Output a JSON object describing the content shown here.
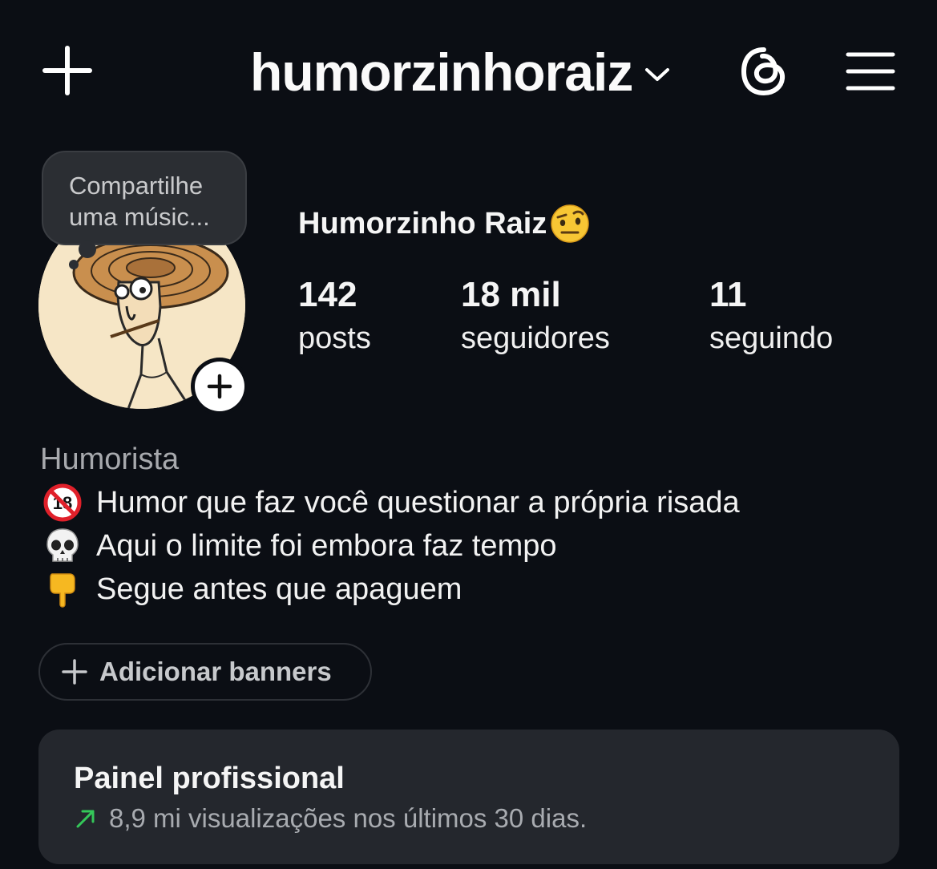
{
  "header": {
    "username": "humorzinhoraiz",
    "icons": [
      "plus-icon",
      "chevron-down-icon",
      "threads-icon",
      "menu-icon"
    ]
  },
  "note_bubble": {
    "text_line1": "Compartilhe",
    "text_line2": "uma músic..."
  },
  "profile": {
    "display_name": "Humorzinho Raiz",
    "stats": [
      {
        "value": "142",
        "label": "posts"
      },
      {
        "value": "18 mil",
        "label": "seguidores"
      },
      {
        "value": "11",
        "label": "seguindo"
      }
    ]
  },
  "bio": {
    "category": "Humorista",
    "lines": [
      {
        "emoji": "no-under-18-icon",
        "text": "Humor que faz você questionar a própria risada"
      },
      {
        "emoji": "skull-icon",
        "text": "Aqui o limite foi embora faz tempo"
      },
      {
        "emoji": "pointing-down-hand-icon",
        "text": "Segue antes que apaguem"
      }
    ]
  },
  "banner_button": {
    "label": "Adicionar banners"
  },
  "dashboard": {
    "title": "Painel profissional",
    "subtitle": "8,9 mi visualizações nos últimos 30 dias.",
    "trend_color": "#34c759"
  },
  "colors": {
    "background": "#0b0e14",
    "card": "#24272d",
    "muted_text": "#a7a9ad"
  }
}
